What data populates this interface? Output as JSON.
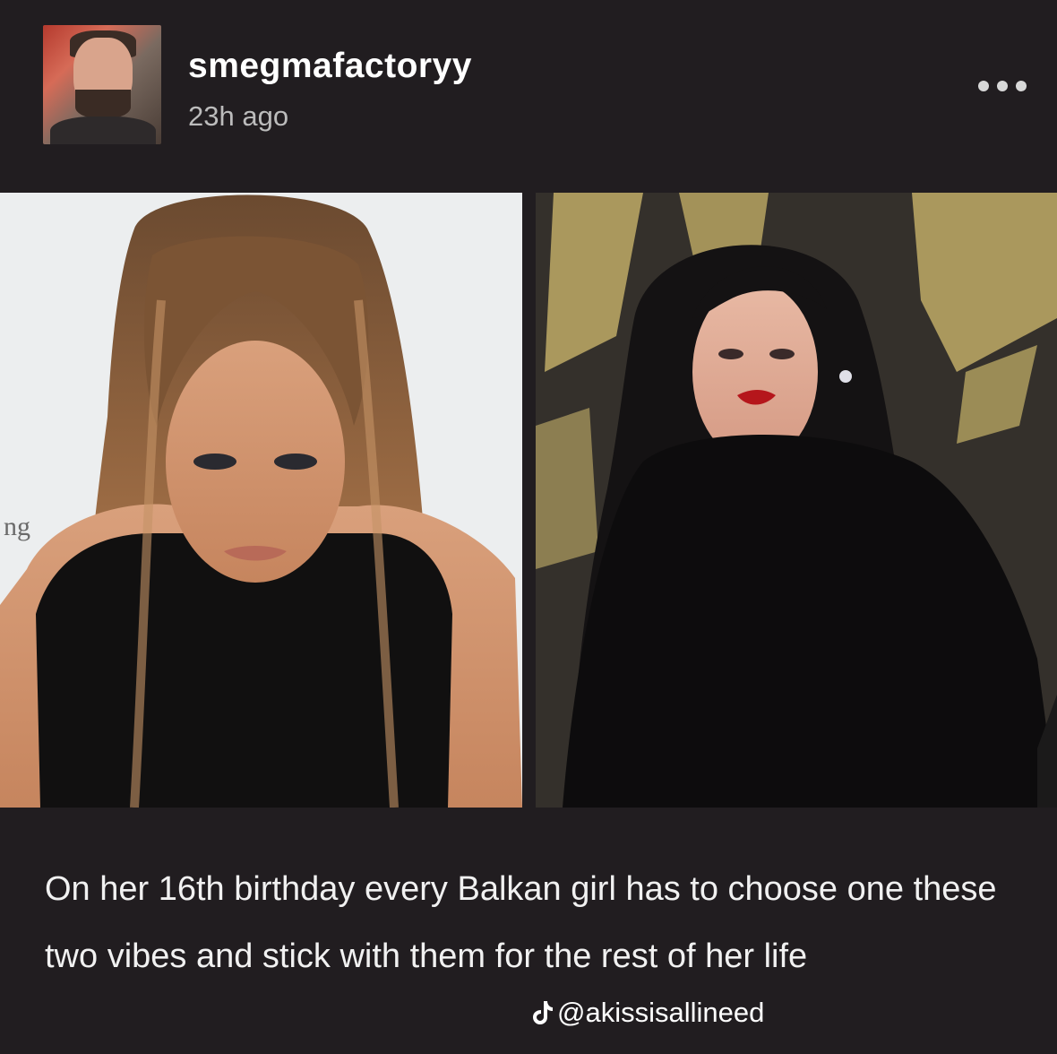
{
  "post": {
    "username": "smegmafactoryy",
    "timestamp": "23h ago",
    "caption": "On her 16th birthday every Balkan girl has to choose one these two vibes and stick with them for the rest of her life"
  },
  "watermark": {
    "handle": "@akissisallineed",
    "icon": "tiktok-icon"
  },
  "icons": {
    "more": "more-options-icon"
  },
  "colors": {
    "background": "#211d20",
    "text": "#f1f1f1",
    "muted": "#bcbcbc"
  }
}
